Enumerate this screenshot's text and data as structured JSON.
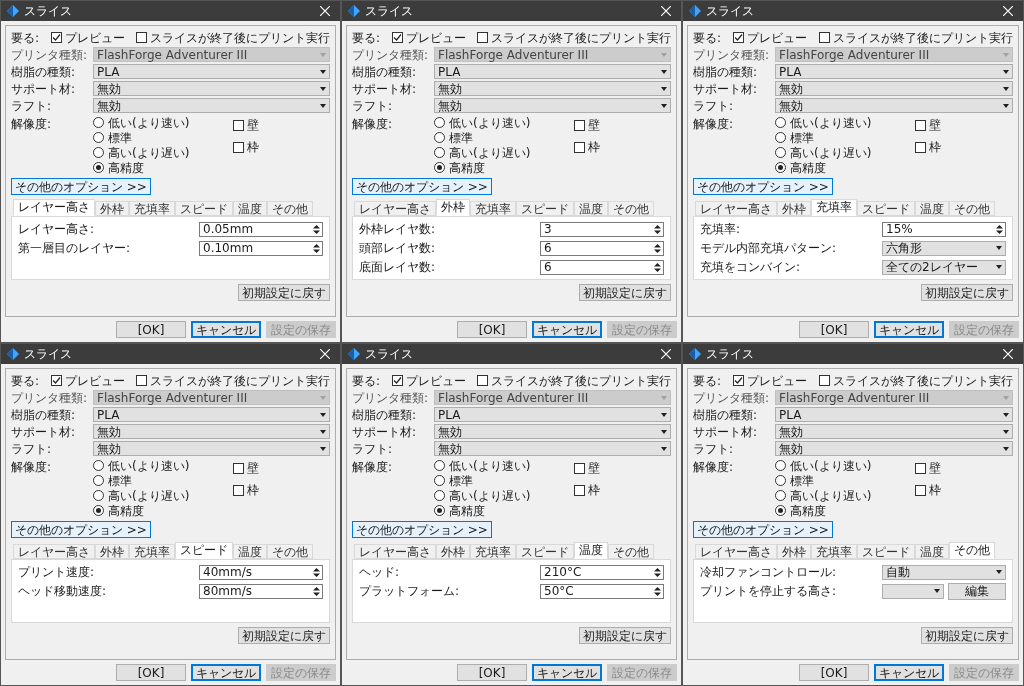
{
  "dialogs": [
    {
      "title": "スライス",
      "top": {
        "label": "要る:",
        "preview": {
          "label": "プレビュー",
          "checked": true
        },
        "print_after": {
          "label": "スライスが終了後にプリント実行",
          "checked": false
        }
      },
      "selects": [
        {
          "label": "プリンタ種類:",
          "value": "FlashForge Adventurer III",
          "disabled": true
        },
        {
          "label": "樹脂の種類:",
          "value": "PLA",
          "disabled": false
        },
        {
          "label": "サポート材:",
          "value": "無効",
          "disabled": false
        },
        {
          "label": "ラフト:",
          "value": "無効",
          "disabled": false
        }
      ],
      "resolution": {
        "label": "解像度:",
        "options": [
          {
            "label": "低い(より速い)",
            "selected": false
          },
          {
            "label": "標準",
            "selected": false
          },
          {
            "label": "高い(より遅い)",
            "selected": false
          },
          {
            "label": "高精度",
            "selected": true
          }
        ]
      },
      "checks": [
        {
          "label": "壁",
          "checked": false
        },
        {
          "label": "枠",
          "checked": false
        }
      ],
      "more_button": "その他のオプション >>",
      "tabs": [
        {
          "label": "レイヤー高さ",
          "selected": true
        },
        {
          "label": "外枠",
          "selected": false
        },
        {
          "label": "充填率",
          "selected": false
        },
        {
          "label": "スピード",
          "selected": false
        },
        {
          "label": "温度",
          "selected": false
        },
        {
          "label": "その他",
          "selected": false
        }
      ],
      "fields": [
        {
          "kind": "spin",
          "label": "レイヤー高さ:",
          "value": "0.05mm"
        },
        {
          "kind": "spin",
          "label": "第一層目のレイヤー:",
          "value": "0.10mm"
        }
      ],
      "reset_button": "初期設定に戻す",
      "buttons": [
        {
          "label": "[OK]",
          "kind": "normal"
        },
        {
          "label": "キャンセル",
          "kind": "default"
        },
        {
          "label": "設定の保存",
          "kind": "disabled"
        }
      ]
    },
    {
      "title": "スライス",
      "top": {
        "label": "要る:",
        "preview": {
          "label": "プレビュー",
          "checked": true
        },
        "print_after": {
          "label": "スライスが終了後にプリント実行",
          "checked": false
        }
      },
      "selects": [
        {
          "label": "プリンタ種類:",
          "value": "FlashForge Adventurer III",
          "disabled": true
        },
        {
          "label": "樹脂の種類:",
          "value": "PLA",
          "disabled": false
        },
        {
          "label": "サポート材:",
          "value": "無効",
          "disabled": false
        },
        {
          "label": "ラフト:",
          "value": "無効",
          "disabled": false
        }
      ],
      "resolution": {
        "label": "解像度:",
        "options": [
          {
            "label": "低い(より速い)",
            "selected": false
          },
          {
            "label": "標準",
            "selected": false
          },
          {
            "label": "高い(より遅い)",
            "selected": false
          },
          {
            "label": "高精度",
            "selected": true
          }
        ]
      },
      "checks": [
        {
          "label": "壁",
          "checked": false
        },
        {
          "label": "枠",
          "checked": false
        }
      ],
      "more_button": "その他のオプション >>",
      "tabs": [
        {
          "label": "レイヤー高さ",
          "selected": false
        },
        {
          "label": "外枠",
          "selected": true
        },
        {
          "label": "充填率",
          "selected": false
        },
        {
          "label": "スピード",
          "selected": false
        },
        {
          "label": "温度",
          "selected": false
        },
        {
          "label": "その他",
          "selected": false
        }
      ],
      "fields": [
        {
          "kind": "spin",
          "label": "外枠レイヤ数:",
          "value": "3"
        },
        {
          "kind": "spin",
          "label": "頭部レイヤ数:",
          "value": "6"
        },
        {
          "kind": "spin",
          "label": "底面レイヤ数:",
          "value": "6"
        }
      ],
      "reset_button": "初期設定に戻す",
      "buttons": [
        {
          "label": "[OK]",
          "kind": "normal"
        },
        {
          "label": "キャンセル",
          "kind": "default"
        },
        {
          "label": "設定の保存",
          "kind": "disabled"
        }
      ]
    },
    {
      "title": "スライス",
      "top": {
        "label": "要る:",
        "preview": {
          "label": "プレビュー",
          "checked": true
        },
        "print_after": {
          "label": "スライスが終了後にプリント実行",
          "checked": false
        }
      },
      "selects": [
        {
          "label": "プリンタ種類:",
          "value": "FlashForge Adventurer III",
          "disabled": true
        },
        {
          "label": "樹脂の種類:",
          "value": "PLA",
          "disabled": false
        },
        {
          "label": "サポート材:",
          "value": "無効",
          "disabled": false
        },
        {
          "label": "ラフト:",
          "value": "無効",
          "disabled": false
        }
      ],
      "resolution": {
        "label": "解像度:",
        "options": [
          {
            "label": "低い(より速い)",
            "selected": false
          },
          {
            "label": "標準",
            "selected": false
          },
          {
            "label": "高い(より遅い)",
            "selected": false
          },
          {
            "label": "高精度",
            "selected": true
          }
        ]
      },
      "checks": [
        {
          "label": "壁",
          "checked": false
        },
        {
          "label": "枠",
          "checked": false
        }
      ],
      "more_button": "その他のオプション >>",
      "tabs": [
        {
          "label": "レイヤー高さ",
          "selected": false
        },
        {
          "label": "外枠",
          "selected": false
        },
        {
          "label": "充填率",
          "selected": true
        },
        {
          "label": "スピード",
          "selected": false
        },
        {
          "label": "温度",
          "selected": false
        },
        {
          "label": "その他",
          "selected": false
        }
      ],
      "fields": [
        {
          "kind": "spin",
          "label": "充填率:",
          "value": "15%"
        },
        {
          "kind": "select",
          "label": "モデル内部充填パターン:",
          "value": "六角形"
        },
        {
          "kind": "select",
          "label": "充填をコンバイン:",
          "value": "全ての2レイヤー"
        }
      ],
      "reset_button": "初期設定に戻す",
      "buttons": [
        {
          "label": "[OK]",
          "kind": "normal"
        },
        {
          "label": "キャンセル",
          "kind": "default"
        },
        {
          "label": "設定の保存",
          "kind": "disabled"
        }
      ]
    },
    {
      "title": "スライス",
      "top": {
        "label": "要る:",
        "preview": {
          "label": "プレビュー",
          "checked": true
        },
        "print_after": {
          "label": "スライスが終了後にプリント実行",
          "checked": false
        }
      },
      "selects": [
        {
          "label": "プリンタ種類:",
          "value": "FlashForge Adventurer III",
          "disabled": true
        },
        {
          "label": "樹脂の種類:",
          "value": "PLA",
          "disabled": false
        },
        {
          "label": "サポート材:",
          "value": "無効",
          "disabled": false
        },
        {
          "label": "ラフト:",
          "value": "無効",
          "disabled": false
        }
      ],
      "resolution": {
        "label": "解像度:",
        "options": [
          {
            "label": "低い(より速い)",
            "selected": false
          },
          {
            "label": "標準",
            "selected": false
          },
          {
            "label": "高い(より遅い)",
            "selected": false
          },
          {
            "label": "高精度",
            "selected": true
          }
        ]
      },
      "checks": [
        {
          "label": "壁",
          "checked": false
        },
        {
          "label": "枠",
          "checked": false
        }
      ],
      "more_button": "その他のオプション >>",
      "tabs": [
        {
          "label": "レイヤー高さ",
          "selected": false
        },
        {
          "label": "外枠",
          "selected": false
        },
        {
          "label": "充填率",
          "selected": false
        },
        {
          "label": "スピード",
          "selected": true
        },
        {
          "label": "温度",
          "selected": false
        },
        {
          "label": "その他",
          "selected": false
        }
      ],
      "fields": [
        {
          "kind": "spin",
          "label": "プリント速度:",
          "value": "40mm/s"
        },
        {
          "kind": "spin",
          "label": "ヘッド移動速度:",
          "value": "80mm/s"
        }
      ],
      "reset_button": "初期設定に戻す",
      "buttons": [
        {
          "label": "[OK]",
          "kind": "normal"
        },
        {
          "label": "キャンセル",
          "kind": "default"
        },
        {
          "label": "設定の保存",
          "kind": "disabled"
        }
      ]
    },
    {
      "title": "スライス",
      "top": {
        "label": "要る:",
        "preview": {
          "label": "プレビュー",
          "checked": true
        },
        "print_after": {
          "label": "スライスが終了後にプリント実行",
          "checked": false
        }
      },
      "selects": [
        {
          "label": "プリンタ種類:",
          "value": "FlashForge Adventurer III",
          "disabled": true
        },
        {
          "label": "樹脂の種類:",
          "value": "PLA",
          "disabled": false
        },
        {
          "label": "サポート材:",
          "value": "無効",
          "disabled": false
        },
        {
          "label": "ラフト:",
          "value": "無効",
          "disabled": false
        }
      ],
      "resolution": {
        "label": "解像度:",
        "options": [
          {
            "label": "低い(より速い)",
            "selected": false
          },
          {
            "label": "標準",
            "selected": false
          },
          {
            "label": "高い(より遅い)",
            "selected": false
          },
          {
            "label": "高精度",
            "selected": true
          }
        ]
      },
      "checks": [
        {
          "label": "壁",
          "checked": false
        },
        {
          "label": "枠",
          "checked": false
        }
      ],
      "more_button": "その他のオプション >>",
      "tabs": [
        {
          "label": "レイヤー高さ",
          "selected": false
        },
        {
          "label": "外枠",
          "selected": false
        },
        {
          "label": "充填率",
          "selected": false
        },
        {
          "label": "スピード",
          "selected": false
        },
        {
          "label": "温度",
          "selected": true
        },
        {
          "label": "その他",
          "selected": false
        }
      ],
      "fields": [
        {
          "kind": "spin",
          "label": "ヘッド:",
          "value": "210°C"
        },
        {
          "kind": "spin",
          "label": "プラットフォーム:",
          "value": "50°C"
        }
      ],
      "reset_button": "初期設定に戻す",
      "buttons": [
        {
          "label": "[OK]",
          "kind": "normal"
        },
        {
          "label": "キャンセル",
          "kind": "default"
        },
        {
          "label": "設定の保存",
          "kind": "disabled"
        }
      ]
    },
    {
      "title": "スライス",
      "top": {
        "label": "要る:",
        "preview": {
          "label": "プレビュー",
          "checked": true
        },
        "print_after": {
          "label": "スライスが終了後にプリント実行",
          "checked": false
        }
      },
      "selects": [
        {
          "label": "プリンタ種類:",
          "value": "FlashForge Adventurer III",
          "disabled": true
        },
        {
          "label": "樹脂の種類:",
          "value": "PLA",
          "disabled": false
        },
        {
          "label": "サポート材:",
          "value": "無効",
          "disabled": false
        },
        {
          "label": "ラフト:",
          "value": "無効",
          "disabled": false
        }
      ],
      "resolution": {
        "label": "解像度:",
        "options": [
          {
            "label": "低い(より速い)",
            "selected": false
          },
          {
            "label": "標準",
            "selected": false
          },
          {
            "label": "高い(より遅い)",
            "selected": false
          },
          {
            "label": "高精度",
            "selected": true
          }
        ]
      },
      "checks": [
        {
          "label": "壁",
          "checked": false
        },
        {
          "label": "枠",
          "checked": false
        }
      ],
      "more_button": "その他のオプション >>",
      "tabs": [
        {
          "label": "レイヤー高さ",
          "selected": false
        },
        {
          "label": "外枠",
          "selected": false
        },
        {
          "label": "充填率",
          "selected": false
        },
        {
          "label": "スピード",
          "selected": false
        },
        {
          "label": "温度",
          "selected": false
        },
        {
          "label": "その他",
          "selected": true
        }
      ],
      "fields": [
        {
          "kind": "select",
          "label": "冷却ファンコントロール:",
          "value": "自動"
        },
        {
          "kind": "select_button",
          "label": "プリントを停止する高さ:",
          "button": "編集"
        }
      ],
      "reset_button": "初期設定に戻す",
      "buttons": [
        {
          "label": "[OK]",
          "kind": "normal"
        },
        {
          "label": "キャンセル",
          "kind": "default"
        },
        {
          "label": "設定の保存",
          "kind": "disabled"
        }
      ]
    }
  ]
}
